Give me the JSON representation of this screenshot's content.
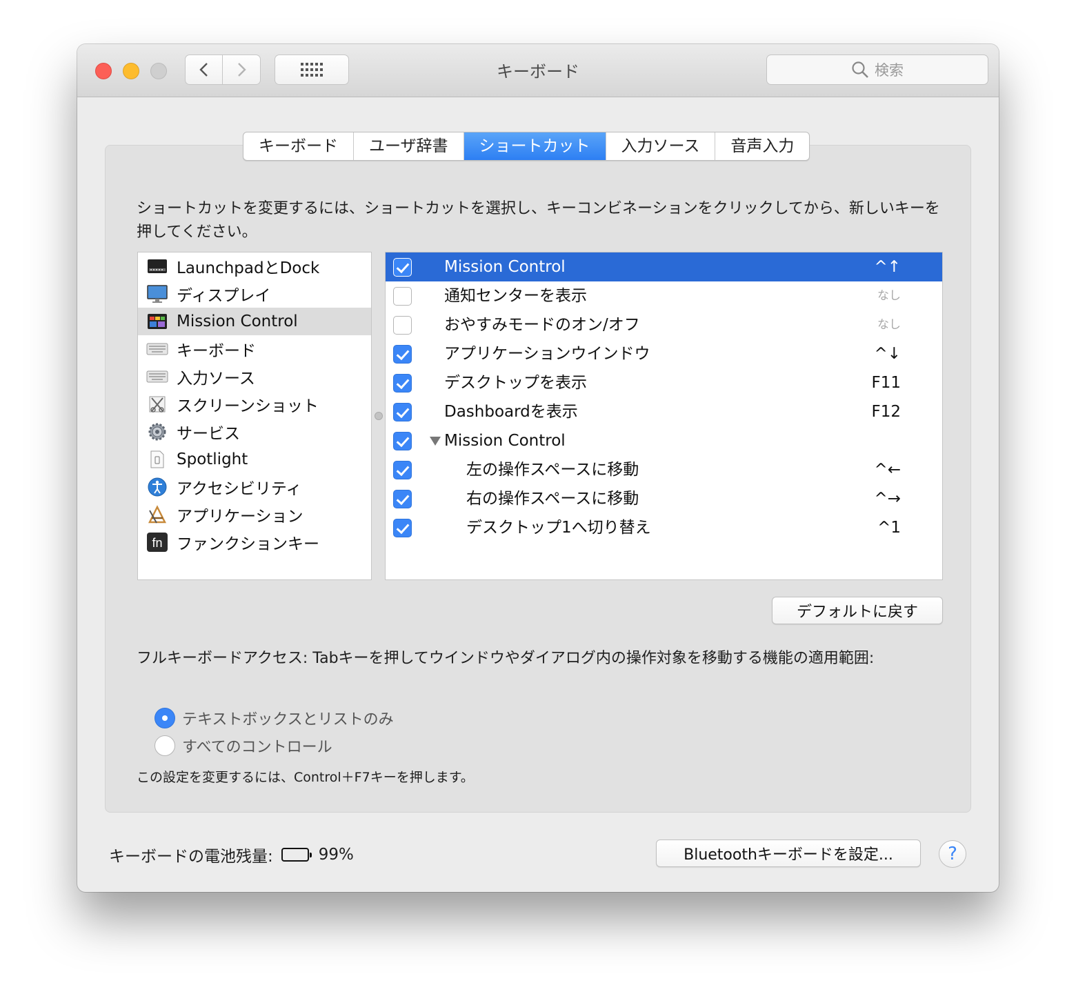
{
  "window": {
    "title": "キーボード"
  },
  "search": {
    "placeholder": "検索"
  },
  "tabs": [
    {
      "label": "キーボード",
      "active": false
    },
    {
      "label": "ユーザ辞書",
      "active": false
    },
    {
      "label": "ショートカット",
      "active": true
    },
    {
      "label": "入力ソース",
      "active": false
    },
    {
      "label": "音声入力",
      "active": false
    }
  ],
  "instructions": "ショートカットを変更するには、ショートカットを選択し、キーコンビネーションをクリックしてから、新しいキーを押してください。",
  "categories": [
    {
      "label": "LaunchpadとDock",
      "icon": "launchpad-dock-icon",
      "selected": false
    },
    {
      "label": "ディスプレイ",
      "icon": "display-icon",
      "selected": false
    },
    {
      "label": "Mission Control",
      "icon": "mission-control-icon",
      "selected": true
    },
    {
      "label": "キーボード",
      "icon": "keyboard-icon",
      "selected": false
    },
    {
      "label": "入力ソース",
      "icon": "input-source-icon",
      "selected": false
    },
    {
      "label": "スクリーンショット",
      "icon": "screenshot-icon",
      "selected": false
    },
    {
      "label": "サービス",
      "icon": "services-gear-icon",
      "selected": false
    },
    {
      "label": "Spotlight",
      "icon": "spotlight-icon",
      "selected": false
    },
    {
      "label": "アクセシビリティ",
      "icon": "accessibility-icon",
      "selected": false
    },
    {
      "label": "アプリケーション",
      "icon": "applications-icon",
      "selected": false
    },
    {
      "label": "ファンクションキー",
      "icon": "fn-key-icon",
      "selected": false
    }
  ],
  "shortcuts": [
    {
      "label": "Mission Control",
      "key": "^↑",
      "checked": true,
      "selected": true,
      "indent": 0
    },
    {
      "label": "通知センターを表示",
      "key": "なし",
      "checked": false,
      "selected": false,
      "indent": 0
    },
    {
      "label": "おやすみモードのオン/オフ",
      "key": "なし",
      "checked": false,
      "selected": false,
      "indent": 0
    },
    {
      "label": "アプリケーションウインドウ",
      "key": "^↓",
      "checked": true,
      "selected": false,
      "indent": 0
    },
    {
      "label": "デスクトップを表示",
      "key": "F11",
      "checked": true,
      "selected": false,
      "indent": 0
    },
    {
      "label": "Dashboardを表示",
      "key": "F12",
      "checked": true,
      "selected": false,
      "indent": 0
    },
    {
      "label": "Mission Control",
      "key": "",
      "checked": true,
      "selected": false,
      "indent": 0,
      "group": true
    },
    {
      "label": "左の操作スペースに移動",
      "key": "^←",
      "checked": true,
      "selected": false,
      "indent": 1
    },
    {
      "label": "右の操作スペースに移動",
      "key": "^→",
      "checked": true,
      "selected": false,
      "indent": 1
    },
    {
      "label": "デスクトップ1へ切り替え",
      "key": "^1",
      "checked": true,
      "selected": false,
      "indent": 1
    }
  ],
  "buttons": {
    "restore_defaults": "デフォルトに戻す",
    "bluetooth_setup": "Bluetoothキーボードを設定...",
    "help": "?"
  },
  "full_keyboard_access": {
    "label": "フルキーボードアクセス: Tabキーを押してウインドウやダイアログ内の操作対象を移動する機能の適用範囲:",
    "options": [
      {
        "label": "テキストボックスとリストのみ",
        "selected": true
      },
      {
        "label": "すべてのコントロール",
        "selected": false
      }
    ],
    "hint": "この設定を変更するには、Control＋F7キーを押します。"
  },
  "battery": {
    "label": "キーボードの電池残量:",
    "percent_text": "99%",
    "level": 0.99
  },
  "colors": {
    "accent": "#3b86f7",
    "selection": "#2a6ad6",
    "tab_active": "#3483f5"
  }
}
